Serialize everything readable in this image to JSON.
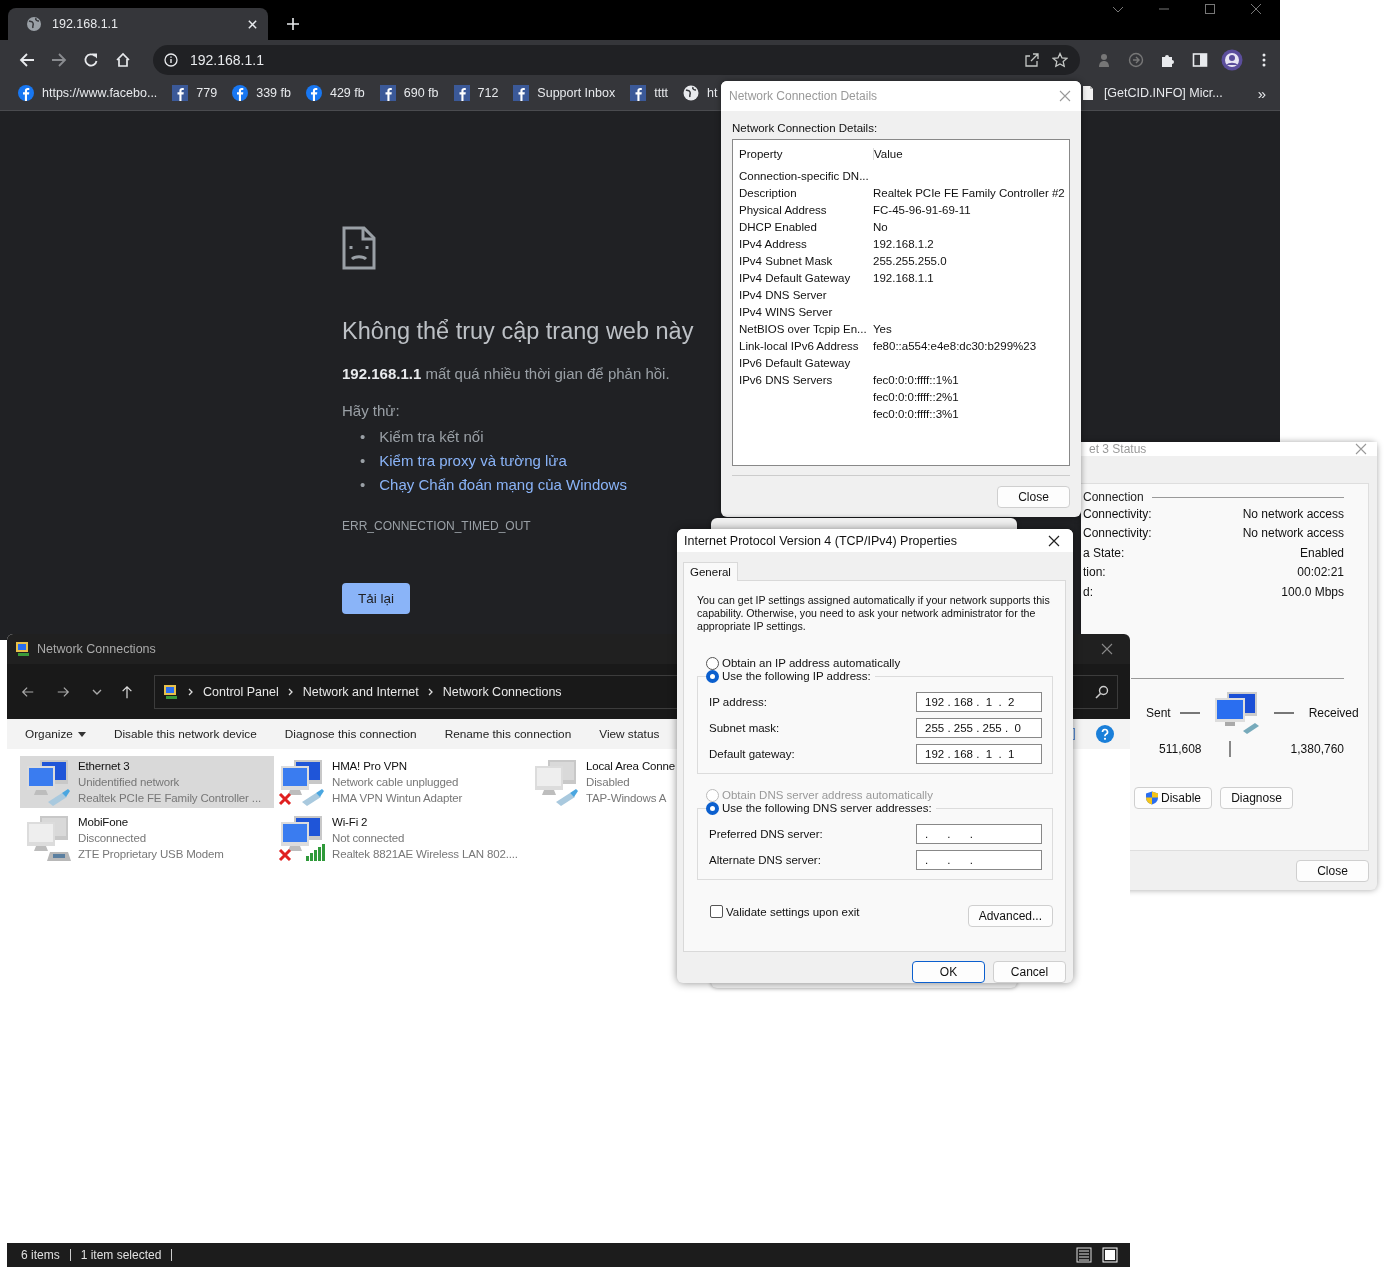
{
  "browser": {
    "tabs": [
      {
        "title": "192.168.1.1",
        "selected": true
      }
    ],
    "address": "192.168.1.1",
    "bookmarks": [
      {
        "label": "https://www.facebo...",
        "kind": "fb-round"
      },
      {
        "label": "779",
        "kind": "fb-square"
      },
      {
        "label": "339 fb",
        "kind": "fb-round"
      },
      {
        "label": "429 fb",
        "kind": "fb-round"
      },
      {
        "label": "690 fb",
        "kind": "fb-square"
      },
      {
        "label": "712",
        "kind": "fb-square"
      },
      {
        "label": "Support Inbox",
        "kind": "fb-square"
      },
      {
        "label": "tttt",
        "kind": "fb-square"
      },
      {
        "label": "ht",
        "kind": "globe"
      },
      {
        "label": "[GetCID.INFO] Micr...",
        "kind": "doc"
      }
    ],
    "more": "»",
    "error": {
      "title": "Không thể truy cập trang web này",
      "message": "**192.168.1.1** mất quá nhiều thời gian để phản hồi.",
      "try_label": "Hãy thử:",
      "suggestions": [
        {
          "bullet": "•",
          "text": "Kiểm tra kết nối",
          "link": false
        },
        {
          "bullet": "•",
          "text": "Kiểm tra proxy và tường lửa",
          "link": true
        },
        {
          "bullet": "•",
          "text": "Chạy Chẩn đoán mạng của Windows",
          "link": true
        }
      ],
      "code": "ERR_CONNECTION_TIMED_OUT",
      "reload": "Tải lại"
    }
  },
  "details": {
    "title": "Network Connection Details",
    "label": "Network Connection Details:",
    "columns": [
      "Property",
      "Value"
    ],
    "rows": [
      {
        "property": "Connection-specific DN...",
        "value": ""
      },
      {
        "property": "Description",
        "value": "Realtek PCIe FE Family Controller #2"
      },
      {
        "property": "Physical Address",
        "value": "FC-45-96-91-69-11"
      },
      {
        "property": "DHCP Enabled",
        "value": "No"
      },
      {
        "property": "IPv4 Address",
        "value": "192.168.1.2"
      },
      {
        "property": "IPv4 Subnet Mask",
        "value": "255.255.255.0"
      },
      {
        "property": "IPv4 Default Gateway",
        "value": "192.168.1.1"
      },
      {
        "property": "IPv4 DNS Server",
        "value": ""
      },
      {
        "property": "IPv4 WINS Server",
        "value": ""
      },
      {
        "property": "NetBIOS over Tcpip En...",
        "value": "Yes"
      },
      {
        "property": "Link-local IPv6 Address",
        "value": "fe80::a554:e4e8:dc30:b299%23"
      },
      {
        "property": "IPv6 Default Gateway",
        "value": ""
      },
      {
        "property": "IPv6 DNS Servers",
        "value": "fec0:0:0:ffff::1%1"
      },
      {
        "property": "",
        "value": "fec0:0:0:ffff::2%1"
      },
      {
        "property": "",
        "value": "fec0:0:0:ffff::3%1"
      }
    ],
    "close": "Close"
  },
  "status": {
    "title": "et 3 Status",
    "group": "Connection",
    "rows": [
      {
        "label": "Connectivity:",
        "value": "No network access"
      },
      {
        "label": "Connectivity:",
        "value": "No network access"
      },
      {
        "label": "a State:",
        "value": "Enabled"
      },
      {
        "label": "tion:",
        "value": "00:02:21"
      },
      {
        "label": "d:",
        "value": "100.0 Mbps"
      }
    ],
    "sent_label": "Sent",
    "received_label": "Received",
    "sent": "511,608",
    "received": "1,380,760",
    "buttons": [
      "Disable",
      "Diagnose"
    ],
    "close": "Close"
  },
  "connections": {
    "title": "Network Connections",
    "breadcrumb": [
      "Control Panel",
      "Network and Internet",
      "Network Connections"
    ],
    "commands": [
      {
        "label": "Organize",
        "dropdown": true
      },
      {
        "label": "Disable this network device",
        "dropdown": false
      },
      {
        "label": "Diagnose this connection",
        "dropdown": false
      },
      {
        "label": "Rename this connection",
        "dropdown": false
      },
      {
        "label": "View status",
        "dropdown": false
      }
    ],
    "items": [
      {
        "name": "Ethernet 3",
        "status": "Unidentified network",
        "device": "Realtek PCIe FE Family Controller ...",
        "kind": "cable",
        "x_mark": false,
        "dimmed": false,
        "selected": true
      },
      {
        "name": "HMA! Pro VPN",
        "status": "Network cable unplugged",
        "device": "HMA VPN Wintun Adapter",
        "kind": "cable",
        "x_mark": true,
        "dimmed": false,
        "selected": false
      },
      {
        "name": "Local Area Conne",
        "status": "Disabled",
        "device": "TAP-Windows A",
        "kind": "cable",
        "x_mark": false,
        "dimmed": true,
        "selected": false
      },
      {
        "name": "MobiFone",
        "status": "Disconnected",
        "device": "ZTE Proprietary USB Modem",
        "kind": "modem",
        "x_mark": false,
        "dimmed": true,
        "selected": false
      },
      {
        "name": "Wi-Fi 2",
        "status": "Not connected",
        "device": "Realtek 8821AE Wireless LAN 802....",
        "kind": "wifi",
        "x_mark": true,
        "dimmed": false,
        "selected": false
      }
    ],
    "status_bar": [
      "6 items",
      "1 item selected"
    ]
  },
  "ipv4": {
    "title": "Internet Protocol Version 4 (TCP/IPv4) Properties",
    "tabs": [
      {
        "label": "General",
        "selected": true
      }
    ],
    "description": "You can get IP settings assigned automatically if your network supports this capability. Otherwise, you need to ask your network administrator for the appropriate IP settings.",
    "ip_options": [
      {
        "label": "Obtain an IP address automatically",
        "selected": false,
        "disabled": false
      },
      {
        "label": "Use the following IP address:",
        "selected": true,
        "disabled": false
      }
    ],
    "ip_fields": [
      {
        "label": "IP address:",
        "value": "192 . 168 .  1  .  2"
      },
      {
        "label": "Subnet mask:",
        "value": "255 . 255 . 255 .  0"
      },
      {
        "label": "Default gateway:",
        "value": "192 . 168 .  1  .  1"
      }
    ],
    "dns_options": [
      {
        "label": "Obtain DNS server address automatically",
        "selected": false,
        "disabled": true
      },
      {
        "label": "Use the following DNS server addresses:",
        "selected": true,
        "disabled": false
      }
    ],
    "dns_fields": [
      {
        "label": "Preferred DNS server:",
        "value": ".      .      ."
      },
      {
        "label": "Alternate DNS server:",
        "value": ".      .      ."
      }
    ],
    "validate": {
      "label": "Validate settings upon exit",
      "checked": false
    },
    "advanced": "Advanced...",
    "ok": "OK",
    "cancel": "Cancel"
  }
}
